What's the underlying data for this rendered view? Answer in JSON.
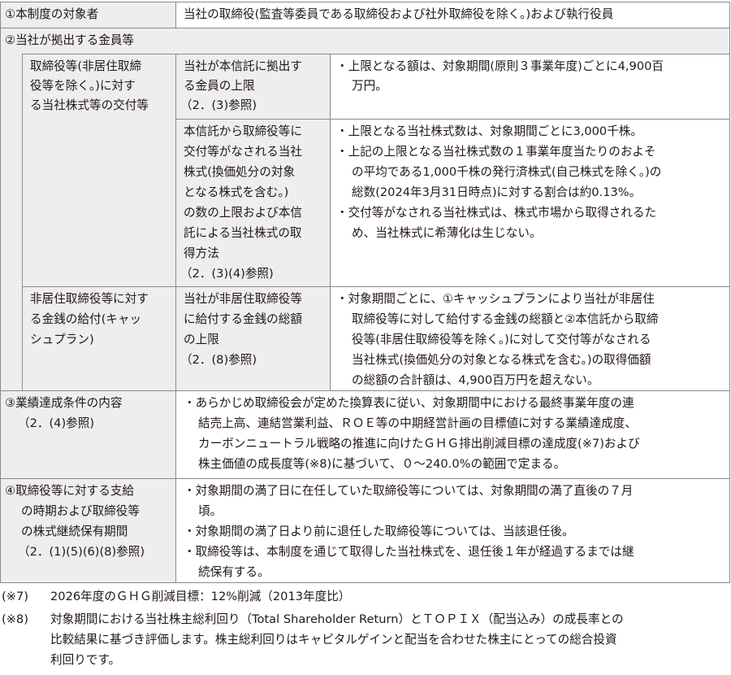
{
  "row1": {
    "label": "①本制度の対象者",
    "value": "当社の取締役(監査等委員である取締役および社外取締役を除く。)および執行役員"
  },
  "row2": {
    "label": "②当社が拠出する金員等",
    "sub1": {
      "label": [
        "取締役等(非居住取締",
        "役等を除く。)に対す",
        "る当社株式等の交付等"
      ],
      "a": {
        "item": [
          "当社が本信託に拠出す",
          "る金員の上限",
          "（2．(3)参照)"
        ],
        "bullets": [
          [
            "・上限となる額は、対象期間(原則３事業年度)ごとに4,900百",
            "万円。"
          ]
        ]
      },
      "b": {
        "item": [
          "本信託から取締役等に",
          "交付等がなされる当社",
          "株式(換価処分の対象",
          "となる株式を含む。)",
          "の数の上限および本信",
          "託による当社株式の取",
          "得方法",
          "（2．(3)(4)参照)"
        ],
        "bullets": [
          [
            "・上限となる当社株式数は、対象期間ごとに3,000千株。"
          ],
          [
            "・上記の上限となる当社株式数の１事業年度当たりのおよそ",
            "の平均である1,000千株の発行済株式(自己株式を除く。)の",
            "総数(2024年3月31日時点)に対する割合は約0.13%。"
          ],
          [
            "・交付等がなされる当社株式は、株式市場から取得されるた",
            "め、当社株式に希薄化は生じない。"
          ]
        ]
      }
    },
    "sub2": {
      "label": [
        "非居住取締役等に対す",
        "る金銭の給付(キャッ",
        "シュプラン)"
      ],
      "item": [
        "当社が非居住取締役等",
        "に給付する金銭の総額",
        "の上限",
        "（2．(8)参照)"
      ],
      "bullets": [
        [
          "・対象期間ごとに、①キャッシュプランにより当社が非居住",
          "取締役等に対して給付する金銭の総額と②本信託から取締",
          "役等(非居住取締役等を除く。)に対して交付等がなされる",
          "当社株式(換価処分の対象となる株式を含む。)の取得価額",
          "の総額の合計額は、4,900百万円を超えない。"
        ]
      ]
    }
  },
  "row3": {
    "label": [
      "③業績達成条件の内容",
      "（2．(4)参照)"
    ],
    "bullets": [
      [
        "・あらかじめ取締役会が定めた換算表に従い、対象期間中における最終事業年度の連",
        "結売上高、連結営業利益、ＲＯＥ等の中期経営計画の目標値に対する業績達成度、",
        "カーボンニュートラル戦略の推進に向けたＧＨＧ排出削減目標の達成度(※7)および",
        "株主価値の成長度等(※8)に基づいて、０～240.0%の範囲で定まる。"
      ]
    ]
  },
  "row4": {
    "label": [
      "④取締役等に対する支給",
      "の時期および取締役等",
      "の株式継続保有期間",
      "（2．(1)(5)(6)(8)参照)"
    ],
    "bullets": [
      [
        "・対象期間の満了日に在任していた取締役等については、対象期間の満了直後の７月",
        "頃。"
      ],
      [
        "・対象期間の満了日より前に退任した取締役等については、当該退任後。"
      ],
      [
        "・取締役等は、本制度を通じて取得した当社株式を、退任後１年が経過するまでは継",
        "続保有する。"
      ]
    ]
  },
  "footnotes": [
    {
      "mark": "(※7)",
      "lines": [
        "2026年度のＧＨＧ削減目標：12%削減（2013年度比）"
      ]
    },
    {
      "mark": "(※8)",
      "lines": [
        "対象期間における当社株主総利回り（Total Shareholder Return）とＴＯＰＩＸ（配当込み）の成長率との",
        "比較結果に基づき評価します。株主総利回りはキャピタルゲインと配当を合わせた株主にとっての総合投資",
        "利回りです。"
      ]
    }
  ]
}
